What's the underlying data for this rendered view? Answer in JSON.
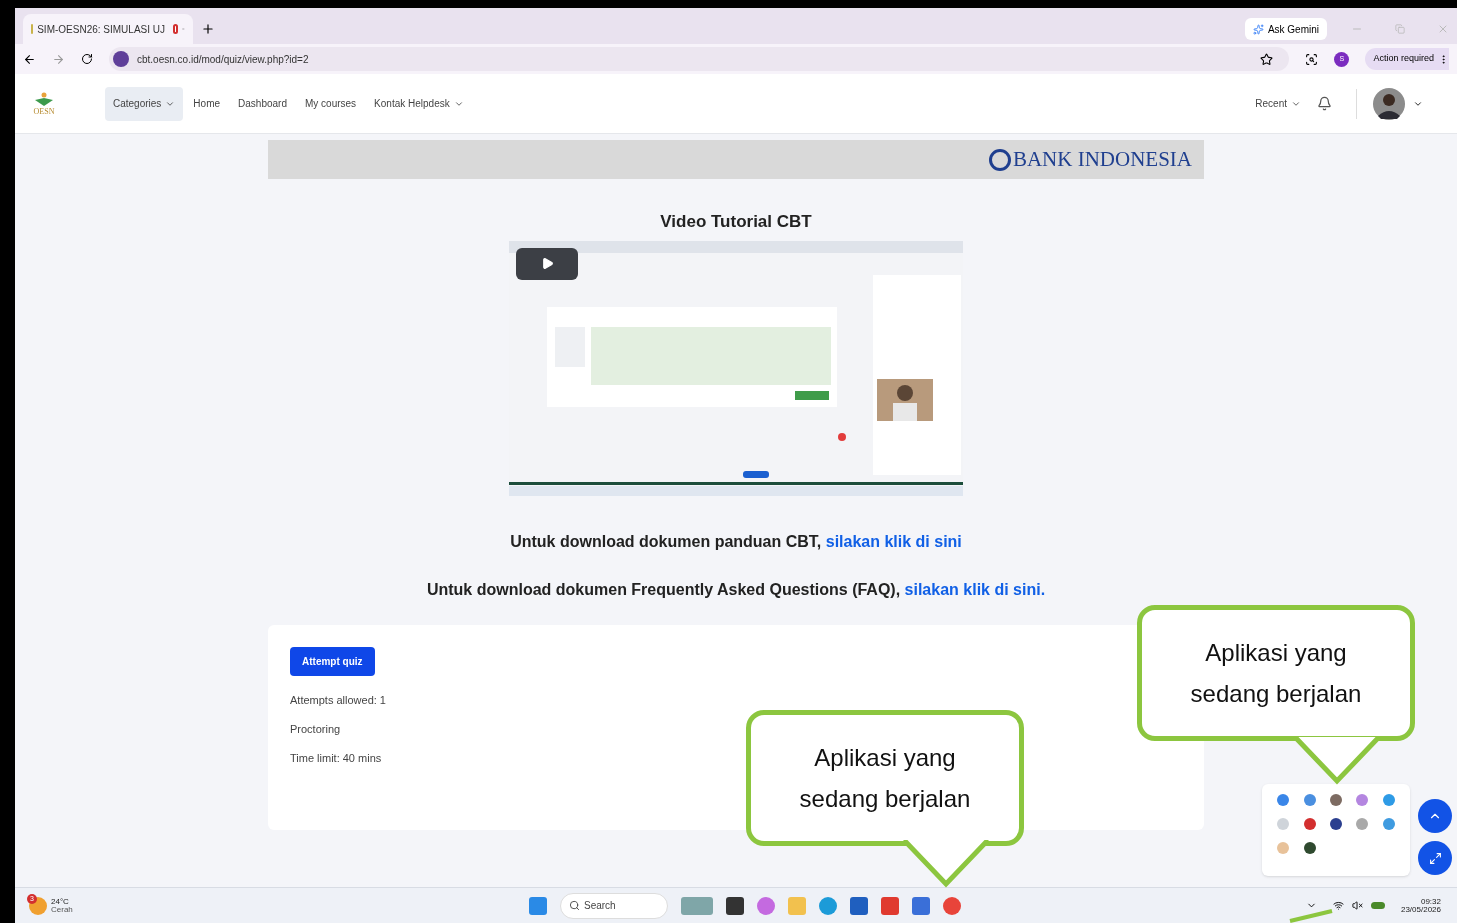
{
  "browser": {
    "tab_title": "SIM-OESN26: SIMULASI UJ",
    "ask_gemini": "Ask Gemini",
    "url": "cbt.oesn.co.id/mod/quiz/view.php?id=2",
    "profile_initial": "S",
    "action_required": "Action required"
  },
  "navbar": {
    "logo_text": "OESN",
    "items": [
      {
        "label": "Categories",
        "dropdown": true,
        "selected": true
      },
      {
        "label": "Home",
        "dropdown": false,
        "selected": false
      },
      {
        "label": "Dashboard",
        "dropdown": false,
        "selected": false
      },
      {
        "label": "My courses",
        "dropdown": false,
        "selected": false
      },
      {
        "label": "Kontak Helpdesk",
        "dropdown": true,
        "selected": false
      }
    ],
    "recent": "Recent"
  },
  "banner": {
    "logo_text": "BANK INDONESIA"
  },
  "video_title": "Video Tutorial CBT",
  "download_lines": [
    {
      "text": "Untuk download dokumen panduan CBT,",
      "link": "silakan klik di sini"
    },
    {
      "text": "Untuk download dokumen Frequently Asked Questions (FAQ),",
      "link": "silakan klik di sini."
    }
  ],
  "quiz": {
    "button": "Attempt quiz",
    "info": [
      "Attempts allowed: 1",
      "Proctoring",
      "Time limit: 40 mins"
    ]
  },
  "callouts": [
    {
      "text": "Aplikasi yang sedang berjalan"
    },
    {
      "text": "Aplikasi yang sedang berjalan"
    }
  ],
  "taskbar": {
    "weather_badge": "3",
    "temperature": "24°C",
    "condition": "Cerah",
    "search": "Search",
    "time": "09:32",
    "date": "23/05/2026"
  }
}
